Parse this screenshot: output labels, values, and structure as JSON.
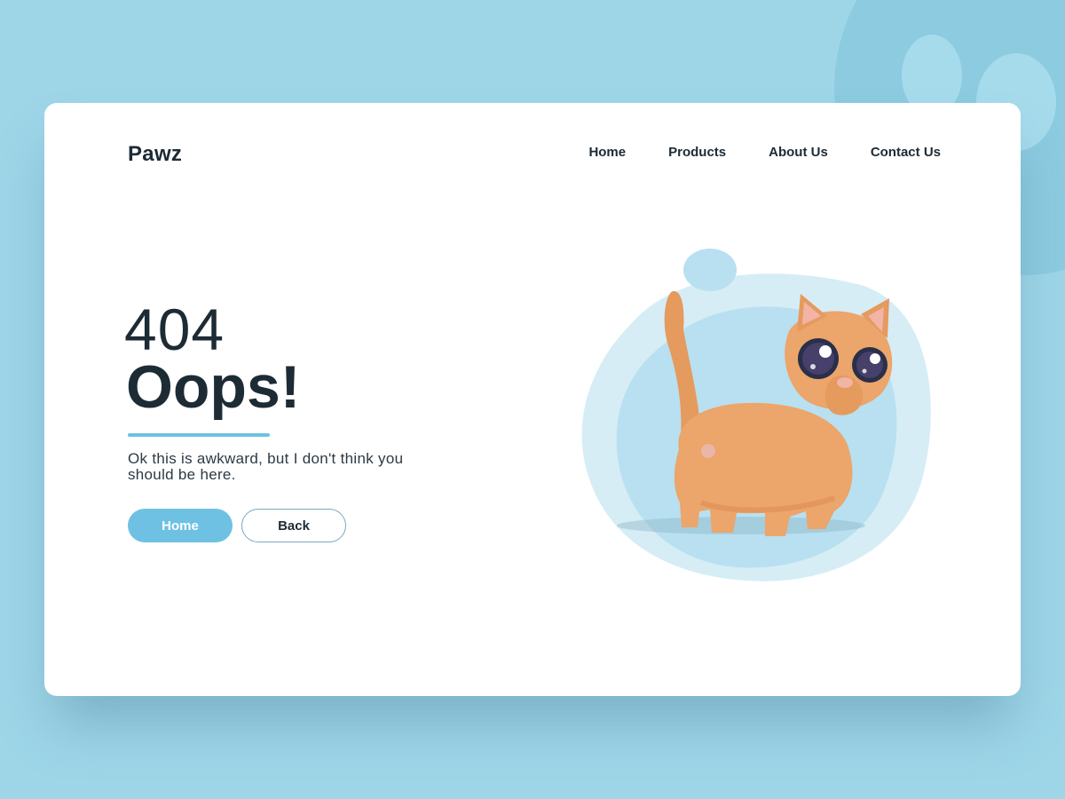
{
  "brand": {
    "logo": "Pawz"
  },
  "nav": {
    "items": [
      "Home",
      "Products",
      "About Us",
      "Contact Us"
    ]
  },
  "hero": {
    "code": "404",
    "headline": "Oops!",
    "message": "Ok this is awkward, but I don't think you should be here."
  },
  "buttons": {
    "home_label": "Home",
    "back_label": "Back"
  },
  "colors": {
    "background": "#9ed6e8",
    "accent": "#6ec1e2",
    "text": "#1d2b35",
    "card": "#ffffff"
  },
  "icons": {
    "background_decoration": "paw-print-icon",
    "illustration": "cat-illustration"
  }
}
